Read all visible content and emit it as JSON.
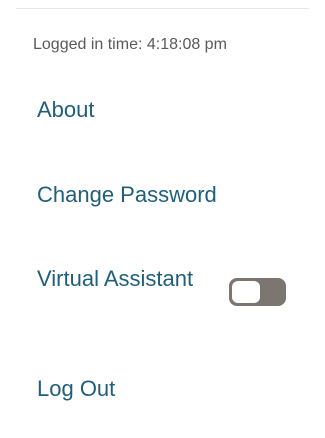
{
  "session": {
    "logged_in_time": "Logged in time: 4:18:08 pm"
  },
  "menu": {
    "about": "About",
    "change_password": "Change Password",
    "virtual_assistant": "Virtual Assistant",
    "log_out": "Log Out"
  },
  "virtual_assistant_toggle": {
    "enabled": false,
    "track_color": "#7c7671",
    "knob_color": "#ffffff"
  },
  "colors": {
    "link": "#1f5f7a",
    "muted_text": "#5a5a5a",
    "background": "#ffffff"
  }
}
